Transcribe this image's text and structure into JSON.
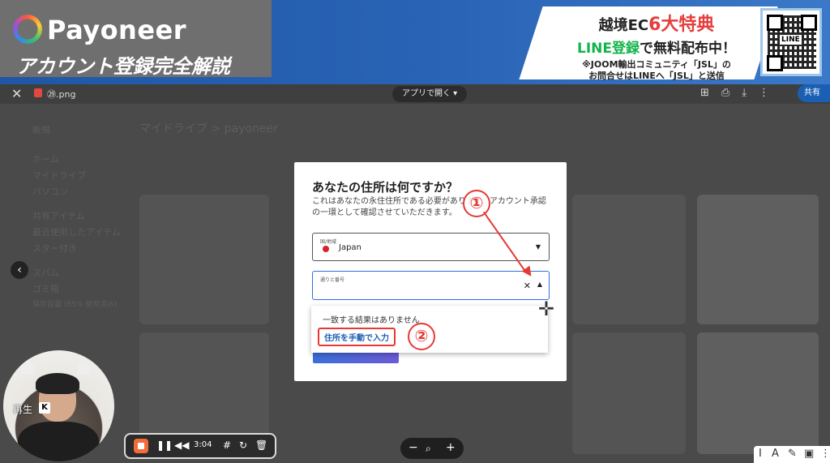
{
  "banner": {
    "logo_text": "Payoneer",
    "subtitle": "アカウント登録完全解説",
    "promo_l1_a": "越境EC",
    "promo_l1_b": "6大特典",
    "promo_l2_a": "LINE登録",
    "promo_l2_b": "で無料配布中！",
    "promo_l3": "※JOOM輸出コミュニティ「JSL」の",
    "promo_l4": "お問合せはLINEへ「JSL」と送信",
    "qr_label": "LINE"
  },
  "viewer": {
    "file_name": "㉙.png",
    "open_with": "アプリで開く",
    "share_label": "共有",
    "ghost_breadcrumb": "マイドライブ  >  payoneer",
    "ghost_sidebar": [
      "新規",
      "ホーム",
      "マイドライブ",
      "パソコン",
      "共有アイテム",
      "最近使用したアイテム",
      "スター付き",
      "スパム",
      "ゴミ箱",
      "保存容量 (85% 使用済み)"
    ]
  },
  "dialog": {
    "title": "あなたの住所は何ですか？",
    "description": "これはあなたの永住住所である必要があります。アカウント承認の一環として確認させていただきます。",
    "country_label": "国/地域",
    "country_value": "Japan",
    "street_label": "通りと番号",
    "street_value": "",
    "no_result": "一致する結果はありません",
    "manual_entry": "住所を手動で入力"
  },
  "annotations": {
    "step1": "①",
    "step2": "②"
  },
  "webcam": {
    "label": "再生",
    "key": "K"
  },
  "recorder": {
    "time": "3:04"
  },
  "colors": {
    "banner_blue": "#2a64b6",
    "accent_red": "#e53935",
    "link_blue": "#1a5fb4",
    "line_green": "#12b34a"
  }
}
